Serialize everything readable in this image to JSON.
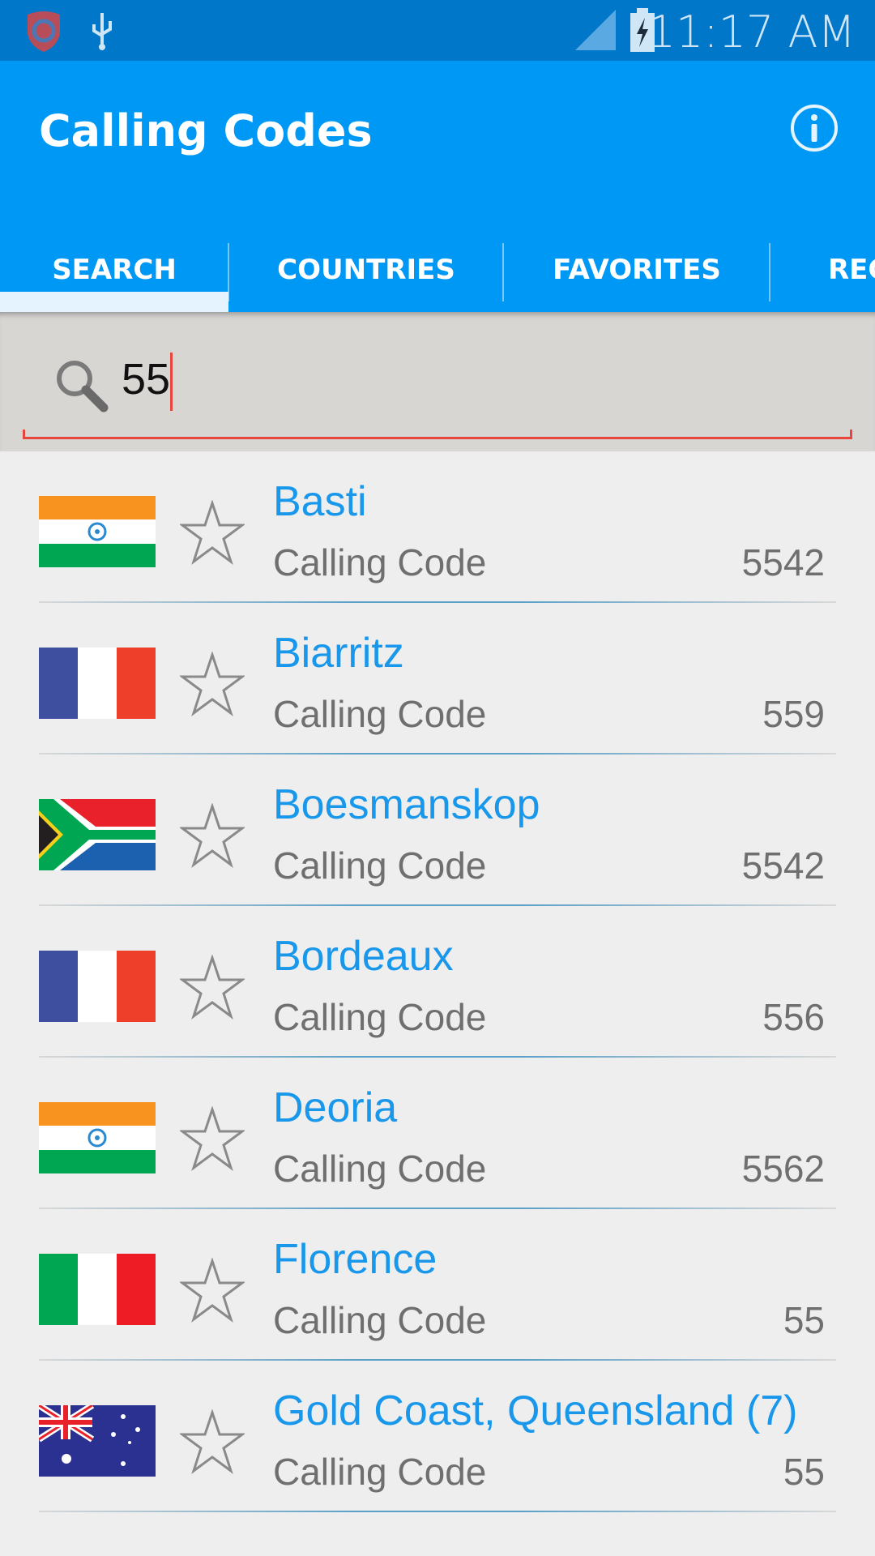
{
  "status_bar": {
    "time": "11:17 AM",
    "left_icons": [
      "shield-app-icon",
      "usb-icon"
    ],
    "right_icons": [
      "signal-icon",
      "battery-charging-icon"
    ]
  },
  "app_bar": {
    "title": "Calling Codes",
    "info_icon": "info-icon"
  },
  "tabs": [
    {
      "label": "SEARCH",
      "selected": true
    },
    {
      "label": "COUNTRIES",
      "selected": false
    },
    {
      "label": "FAVORITES",
      "selected": false
    },
    {
      "label": "REC",
      "selected": false
    }
  ],
  "search": {
    "value": "55",
    "icon": "search-icon"
  },
  "results": [
    {
      "city": "Basti",
      "label": "Calling Code",
      "code": "5542",
      "flag": "india",
      "favorite": false
    },
    {
      "city": "Biarritz",
      "label": "Calling Code",
      "code": "559",
      "flag": "france",
      "favorite": false
    },
    {
      "city": "Boesmanskop",
      "label": "Calling Code",
      "code": "5542",
      "flag": "south-africa",
      "favorite": false
    },
    {
      "city": "Bordeaux",
      "label": "Calling Code",
      "code": "556",
      "flag": "france",
      "favorite": false
    },
    {
      "city": "Deoria",
      "label": "Calling Code",
      "code": "5562",
      "flag": "india",
      "favorite": false
    },
    {
      "city": "Florence",
      "label": "Calling Code",
      "code": "55",
      "flag": "italy",
      "favorite": false
    },
    {
      "city": "Gold Coast, Queensland (7)",
      "label": "Calling Code",
      "code": "55",
      "flag": "australia",
      "favorite": false
    }
  ],
  "colors": {
    "status_bar": "#0077c8",
    "app_bar": "#0098f5",
    "accent": "#1897eb",
    "search_underline": "#e8453c"
  }
}
